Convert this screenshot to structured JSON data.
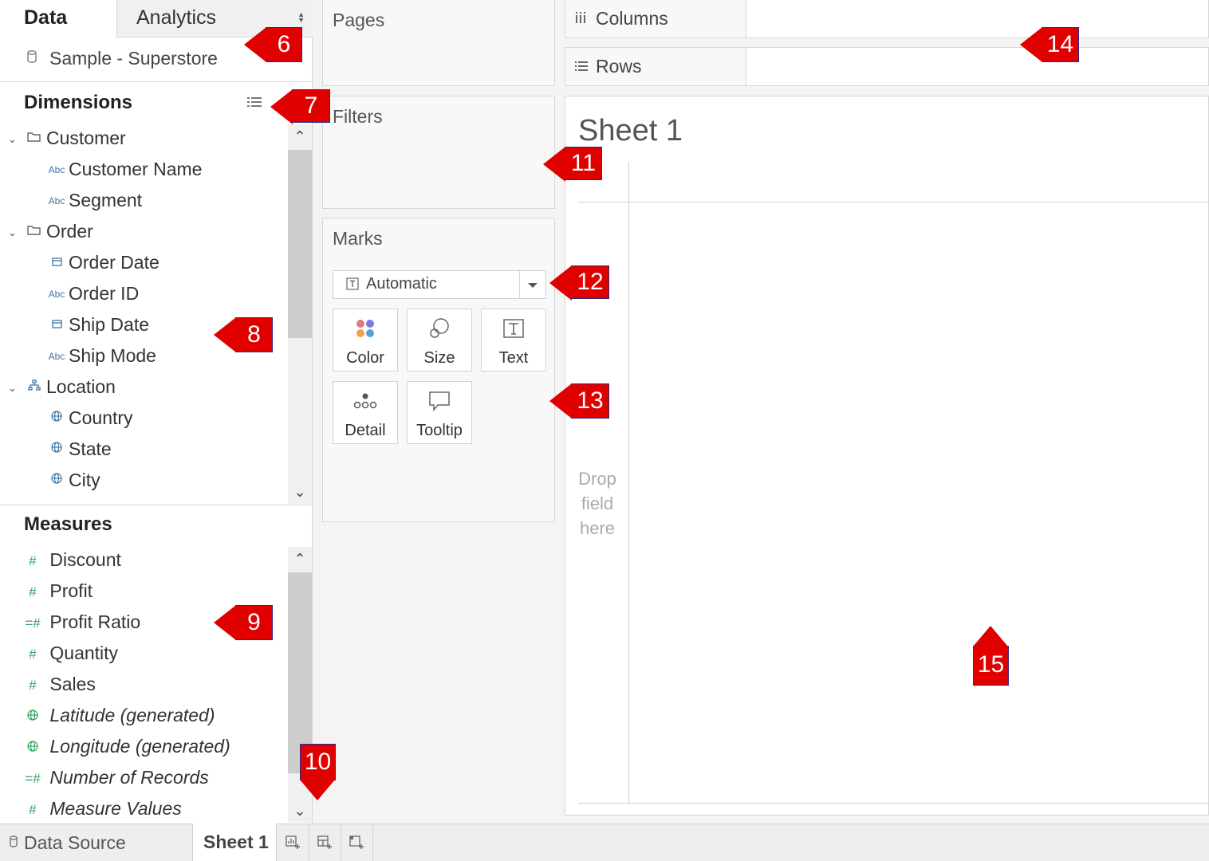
{
  "tabs": {
    "data": "Data",
    "analytics": "Analytics"
  },
  "data_source": {
    "name": "Sample - Superstore"
  },
  "dimensions": {
    "title": "Dimensions",
    "groups": [
      {
        "label": "Customer",
        "fields": [
          "Customer Name",
          "Segment"
        ]
      },
      {
        "label": "Order",
        "fields": [
          "Order Date",
          "Order ID",
          "Ship Date",
          "Ship Mode"
        ]
      },
      {
        "label": "Location",
        "fields": [
          "Country",
          "State",
          "City"
        ]
      }
    ],
    "type_icon_text": "Abc"
  },
  "measures": {
    "title": "Measures",
    "fields": [
      "Discount",
      "Profit",
      "Profit Ratio",
      "Quantity",
      "Sales",
      "Latitude (generated)",
      "Longitude (generated)",
      "Number of Records",
      "Measure Values"
    ]
  },
  "cards": {
    "pages": "Pages",
    "filters": "Filters",
    "marks": "Marks"
  },
  "marks": {
    "type": "Automatic",
    "buttons": [
      "Color",
      "Size",
      "Text",
      "Detail",
      "Tooltip"
    ]
  },
  "shelves": {
    "columns": "Columns",
    "rows": "Rows"
  },
  "sheet": {
    "title": "Sheet 1",
    "drop_hint": [
      "Drop",
      "field",
      "here"
    ]
  },
  "bottom": {
    "data_source_tab": "Data Source",
    "sheet_tab": "Sheet 1"
  },
  "callouts": [
    "6",
    "7",
    "8",
    "9",
    "10",
    "11",
    "12",
    "13",
    "14",
    "15"
  ],
  "colors": {
    "callout": "#e00000",
    "dimension_icon": "#3f76a5",
    "measure_icon": "#2da35f"
  }
}
